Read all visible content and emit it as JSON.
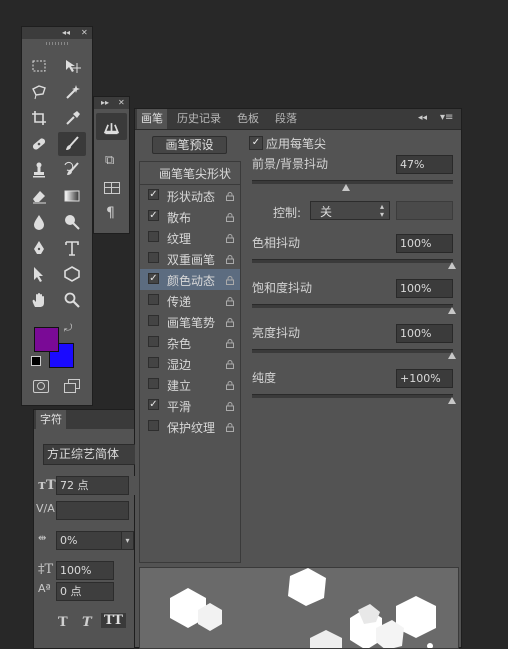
{
  "toolbox": {
    "tools": [
      "rect-marquee",
      "move",
      "lasso",
      "magic-wand",
      "crop",
      "eyedropper",
      "healing-brush",
      "brush",
      "clone-stamp",
      "history-brush",
      "eraser",
      "gradient",
      "blur",
      "dodge",
      "pen",
      "type",
      "path-select",
      "shape",
      "hand",
      "zoom"
    ],
    "active_tool": "brush",
    "foreground_color": "#7a0a96",
    "background_color": "#1a0aff"
  },
  "brush_panel": {
    "tabs": [
      "画笔",
      "历史记录",
      "色板",
      "段落"
    ],
    "active_tab": "画笔",
    "presets_button": "画笔预设",
    "tip_shape_header": "画笔笔尖形状",
    "apply_per_tip": "应用每笔尖",
    "list": [
      {
        "label": "形状动态",
        "checked": true,
        "selected": false
      },
      {
        "label": "散布",
        "checked": true,
        "selected": false
      },
      {
        "label": "纹理",
        "checked": false,
        "selected": false
      },
      {
        "label": "双重画笔",
        "checked": false,
        "selected": false
      },
      {
        "label": "颜色动态",
        "checked": true,
        "selected": true
      },
      {
        "label": "传递",
        "checked": false,
        "selected": false
      },
      {
        "label": "画笔笔势",
        "checked": false,
        "selected": false
      },
      {
        "label": "杂色",
        "checked": false,
        "selected": false
      },
      {
        "label": "湿边",
        "checked": false,
        "selected": false
      },
      {
        "label": "建立",
        "checked": false,
        "selected": false
      },
      {
        "label": "平滑",
        "checked": true,
        "selected": false
      },
      {
        "label": "保护纹理",
        "checked": false,
        "selected": false
      }
    ],
    "fg_bg_jitter": {
      "label": "前景/背景抖动",
      "value": "47%",
      "fraction": 0.47
    },
    "control": {
      "label": "控制:",
      "selected": "关"
    },
    "hue_jitter": {
      "label": "色相抖动",
      "value": "100%",
      "fraction": 1.0
    },
    "saturation_jitter": {
      "label": "饱和度抖动",
      "value": "100%",
      "fraction": 1.0
    },
    "brightness_jitter": {
      "label": "亮度抖动",
      "value": "100%",
      "fraction": 1.0
    },
    "purity": {
      "label": "纯度",
      "value": "+100%",
      "fraction": 1.0
    }
  },
  "character_panel": {
    "tab": "字符",
    "font_family": "方正综艺简体",
    "font_size": "72 点",
    "kerning": "0%",
    "vertical_scale": "100%",
    "baseline_shift": "0 点",
    "style_buttons": [
      "T",
      "T",
      "TT"
    ]
  },
  "colors": {
    "panel_bg": "#535353",
    "selection": "#5c6c80"
  }
}
